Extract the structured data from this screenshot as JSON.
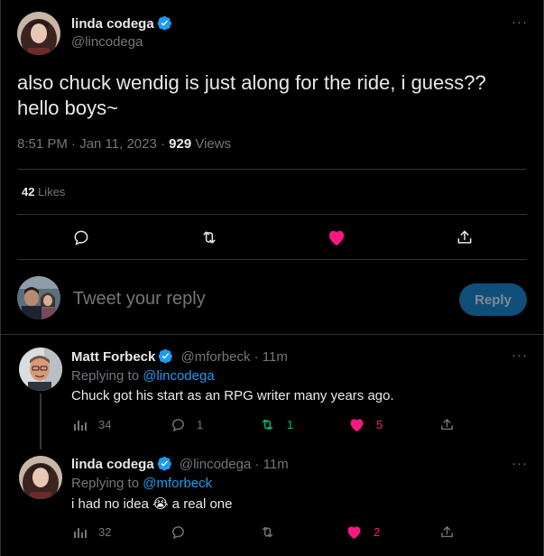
{
  "main_tweet": {
    "author_name": "linda codega",
    "author_handle": "@lincodega",
    "text_line1": "also chuck wendig is just along for the ride, i guess??",
    "text_line2": "hello boys~",
    "time": "8:51 PM · Jan 11, 2023 · ",
    "views_count": "929",
    "views_label": " Views",
    "likes_count": "42",
    "likes_label": " Likes",
    "more": "···"
  },
  "composer": {
    "placeholder": "Tweet your reply",
    "button_label": "Reply"
  },
  "replies": [
    {
      "author_name": "Matt Forbeck",
      "author_handle": "@mforbeck",
      "age": " · 11m",
      "replying_prefix": "Replying to ",
      "replying_to": "@lincodega",
      "text": "Chuck got his start as an RPG writer many years ago.",
      "views": "34",
      "replies": "1",
      "retweets": "1",
      "likes": "5",
      "more": "···"
    },
    {
      "author_name": "linda codega",
      "author_handle": "@lincodega",
      "age": " · 11m",
      "replying_prefix": "Replying to ",
      "replying_to": "@mforbeck",
      "text_before": "i had no idea ",
      "emoji": "😭",
      "text_after": " a real one",
      "views": "32",
      "likes": "2",
      "more": "···"
    }
  ],
  "colors": {
    "background": "#000000",
    "text": "#e7e9ea",
    "muted": "#71767b",
    "link": "#1d9bf0",
    "like": "#f91880",
    "retweet": "#00ba7c",
    "divider": "#2f3336"
  }
}
